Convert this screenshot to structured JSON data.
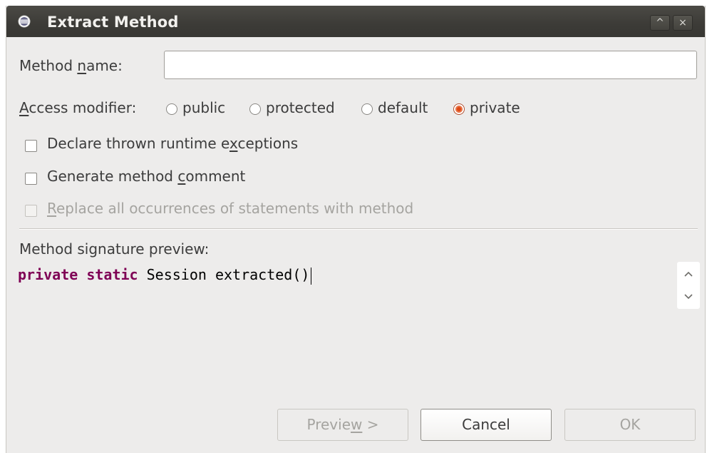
{
  "window": {
    "title": "Extract Method",
    "minimize_glyph": "^",
    "close_glyph": "×"
  },
  "method_name": {
    "label_pre": "Method ",
    "label_mnemonic": "n",
    "label_post": "ame:",
    "value": "",
    "placeholder": ""
  },
  "access_modifier": {
    "label_mnemonic": "A",
    "label_post": "ccess modifier:",
    "options": [
      "public",
      "protected",
      "default",
      "private"
    ],
    "selected": "private"
  },
  "options": {
    "declare_exceptions": {
      "pre": "Declare thrown runtime e",
      "mnemonic": "x",
      "post": "ceptions",
      "checked": false,
      "enabled": true
    },
    "generate_comment": {
      "pre": "Generate method ",
      "mnemonic": "c",
      "post": "omment",
      "checked": false,
      "enabled": true
    },
    "replace_occurrences": {
      "pre": "",
      "mnemonic": "R",
      "post": "eplace all occurrences of statements with method",
      "checked": false,
      "enabled": false
    }
  },
  "preview": {
    "label": "Method signature preview:",
    "kw1": "private",
    "kw2": "static",
    "rest": " Session extracted()"
  },
  "buttons": {
    "preview_pre": "Previe",
    "preview_mnemonic": "w",
    "preview_post": " >",
    "cancel": "Cancel",
    "ok": "OK"
  },
  "colors": {
    "keyword": "#7f0055",
    "radio_selected": "#dd4814",
    "titlebar": "#3c3b37"
  }
}
